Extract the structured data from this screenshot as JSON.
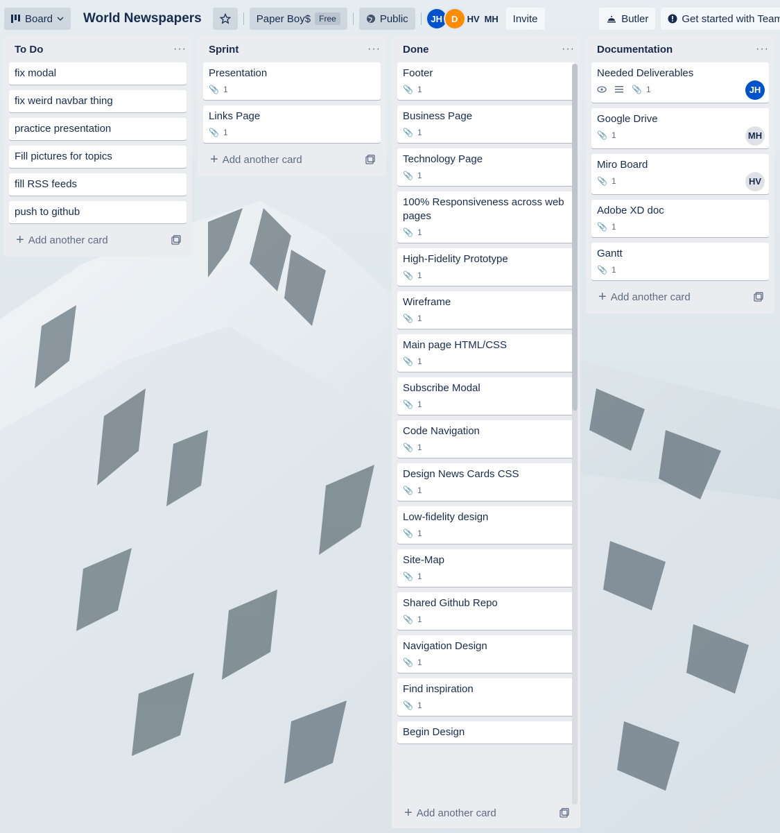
{
  "header": {
    "view_label": "Board",
    "board_title": "World Newspapers",
    "workspace_label": "Paper Boy$",
    "plan_badge": "Free",
    "visibility_label": "Public",
    "members": [
      "JH",
      "D",
      "HV",
      "MH"
    ],
    "invite_label": "Invite",
    "butler_label": "Butler",
    "team_label": "Get started with Team"
  },
  "lists": [
    {
      "title": "To Do",
      "cards": [
        {
          "title": "fix modal"
        },
        {
          "title": "fix weird navbar thing"
        },
        {
          "title": "practice presentation"
        },
        {
          "title": "Fill pictures for topics"
        },
        {
          "title": "fill RSS feeds"
        },
        {
          "title": "push to github"
        }
      ],
      "add_label": "Add another card"
    },
    {
      "title": "Sprint",
      "cards": [
        {
          "title": "Presentation",
          "attachments": "1"
        },
        {
          "title": "Links Page",
          "attachments": "1"
        }
      ],
      "add_label": "Add another card"
    },
    {
      "title": "Done",
      "cards": [
        {
          "title": "Footer",
          "attachments": "1"
        },
        {
          "title": "Business Page",
          "attachments": "1"
        },
        {
          "title": "Technology Page",
          "attachments": "1"
        },
        {
          "title": "100% Responsiveness across web pages",
          "attachments": "1"
        },
        {
          "title": "High-Fidelity Prototype",
          "attachments": "1"
        },
        {
          "title": "Wireframe",
          "attachments": "1"
        },
        {
          "title": "Main page HTML/CSS",
          "attachments": "1"
        },
        {
          "title": "Subscribe Modal",
          "attachments": "1"
        },
        {
          "title": "Code Navigation",
          "attachments": "1"
        },
        {
          "title": "Design News Cards CSS",
          "attachments": "1"
        },
        {
          "title": "Low-fidelity design",
          "attachments": "1"
        },
        {
          "title": "Site-Map",
          "attachments": "1"
        },
        {
          "title": "Shared Github Repo",
          "attachments": "1"
        },
        {
          "title": "Navigation Design",
          "attachments": "1"
        },
        {
          "title": "Find inspiration",
          "attachments": "1"
        },
        {
          "title": "Begin Design"
        }
      ],
      "add_label": "Add another card"
    },
    {
      "title": "Documentation",
      "cards": [
        {
          "title": "Needed Deliverables",
          "attachments": "1",
          "member": "JH"
        },
        {
          "title": "Google Drive",
          "attachments": "1",
          "member": "MH"
        },
        {
          "title": "Miro Board",
          "attachments": "1",
          "member": "HV"
        },
        {
          "title": "Adobe XD doc",
          "attachments": "1"
        },
        {
          "title": "Gantt",
          "attachments": "1"
        }
      ],
      "add_label": "Add another card"
    }
  ],
  "colors": {
    "list_bg": "#ebecf0",
    "card_bg": "#ffffff",
    "text": "#172b4d",
    "muted": "#5e6c84",
    "avatar_blue": "#0052cc",
    "avatar_orange": "#ff8b00"
  }
}
